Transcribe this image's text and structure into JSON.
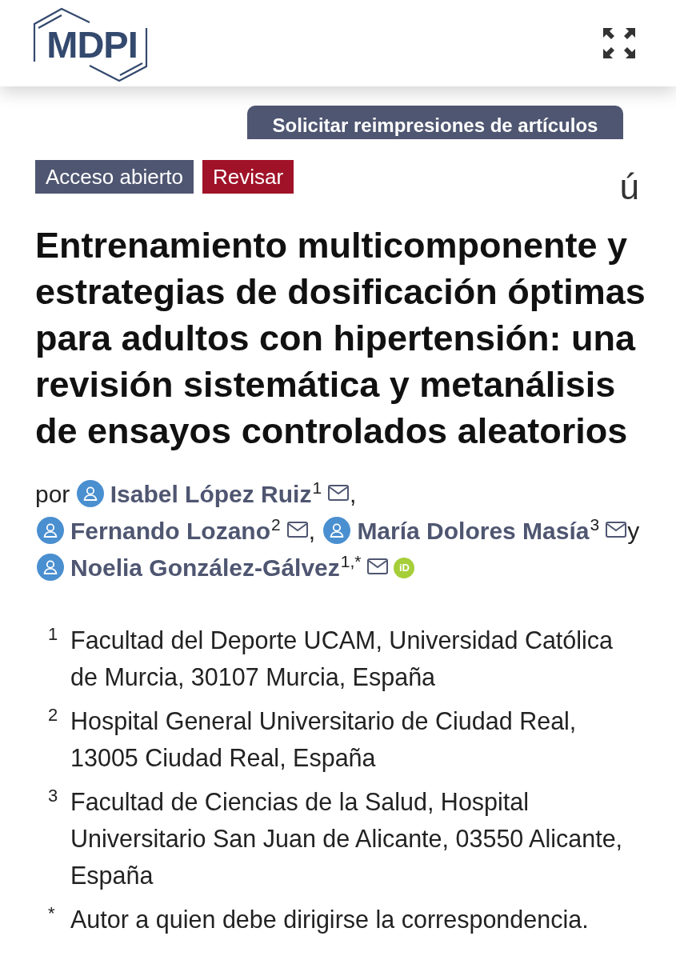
{
  "header": {
    "logo": "MDPI"
  },
  "reprint_button": "Solicitar reimpresiones de artículos",
  "badges": [
    {
      "label": "Acceso abierto",
      "kind": "access"
    },
    {
      "label": "Revisar",
      "kind": "type"
    }
  ],
  "corner_glyph": "ú",
  "title": "Entrenamiento multicomponente y estrategias de dosificación óptimas para adultos con hipertensión: una revisión sistemática y metanálisis de ensayos controlados aleatorios",
  "authors": {
    "prefix": "por",
    "list": [
      {
        "name": "Isabel López Ruiz",
        "mark": "1",
        "separator": ",",
        "orcid": false
      },
      {
        "name": "Fernando Lozano",
        "mark": "2",
        "separator": ",",
        "orcid": false
      },
      {
        "name": "María Dolores Masía",
        "mark": "3",
        "separator": "y",
        "orcid": false
      },
      {
        "name": "Noelia González-Gálvez",
        "mark": "1,*",
        "orcid": true,
        "orcid_label": "iD"
      }
    ]
  },
  "affiliations": [
    {
      "mark": "1",
      "text": "Facultad del Deporte UCAM, Universidad Católica de Murcia, 30107 Murcia, España"
    },
    {
      "mark": "2",
      "text": "Hospital General Universitario de Ciudad Real, 13005 Ciudad Real, España"
    },
    {
      "mark": "3",
      "text": "Facultad de Ciencias de la Salud, Hospital Universitario San Juan de Alicante, 03550 Alicante, España"
    },
    {
      "mark": "*",
      "text": "Autor a quien debe dirigirse la correspondencia."
    }
  ]
}
